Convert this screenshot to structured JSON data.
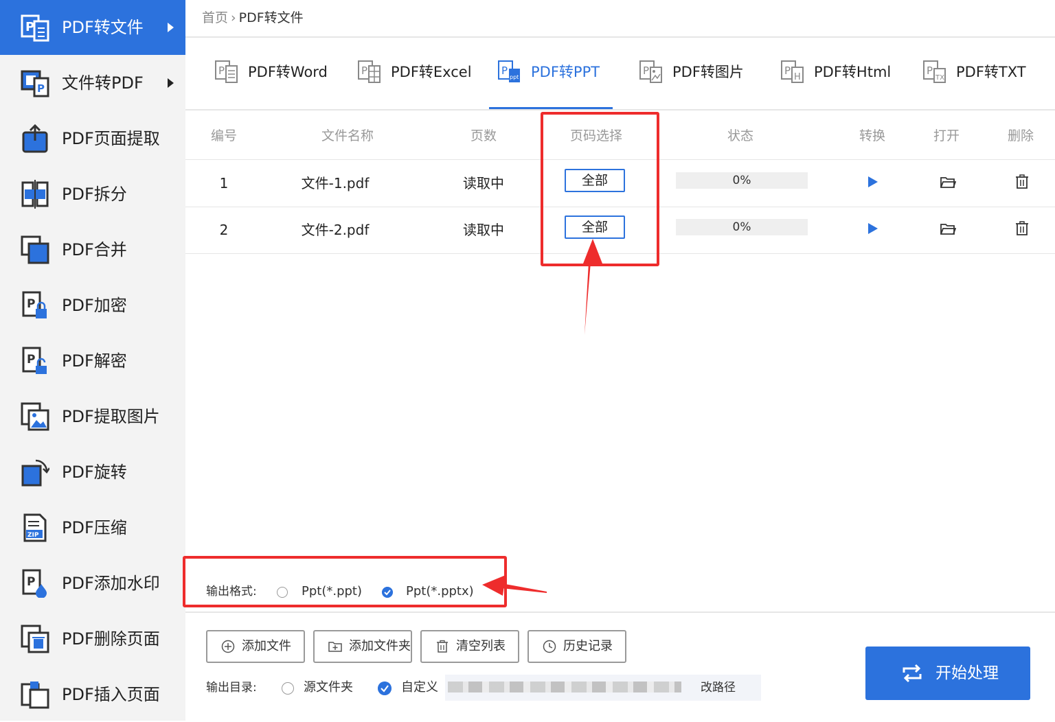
{
  "sidebar": {
    "items": [
      {
        "label": "PDF转文件",
        "icon": "pdf-to-file-icon",
        "active": true,
        "arrow": true
      },
      {
        "label": "文件转PDF",
        "icon": "file-to-pdf-icon",
        "arrow": true
      },
      {
        "label": "PDF页面提取",
        "icon": "page-extract-icon"
      },
      {
        "label": "PDF拆分",
        "icon": "split-icon"
      },
      {
        "label": "PDF合并",
        "icon": "merge-icon"
      },
      {
        "label": "PDF加密",
        "icon": "encrypt-icon"
      },
      {
        "label": "PDF解密",
        "icon": "decrypt-icon"
      },
      {
        "label": "PDF提取图片",
        "icon": "image-extract-icon"
      },
      {
        "label": "PDF旋转",
        "icon": "rotate-icon"
      },
      {
        "label": "PDF压缩",
        "icon": "zip-icon"
      },
      {
        "label": "PDF添加水印",
        "icon": "watermark-icon"
      },
      {
        "label": "PDF删除页面",
        "icon": "delete-page-icon"
      },
      {
        "label": "PDF插入页面",
        "icon": "insert-page-icon"
      }
    ]
  },
  "breadcrumb": {
    "home": "首页",
    "separator": "›",
    "current": "PDF转文件"
  },
  "tabs": [
    {
      "label": "PDF转Word",
      "icon": "word-icon"
    },
    {
      "label": "PDF转Excel",
      "icon": "excel-icon"
    },
    {
      "label": "PDF转PPT",
      "icon": "ppt-icon",
      "active": true
    },
    {
      "label": "PDF转图片",
      "icon": "image-icon"
    },
    {
      "label": "PDF转Html",
      "icon": "html-icon"
    },
    {
      "label": "PDF转TXT",
      "icon": "txt-icon"
    }
  ],
  "table": {
    "headers": [
      "编号",
      "文件名称",
      "页数",
      "页码选择",
      "状态",
      "转换",
      "打开",
      "删除"
    ],
    "rows": [
      {
        "no": "1",
        "name": "文件-1.pdf",
        "pages": "读取中",
        "page_select": "全部",
        "status": "0%"
      },
      {
        "no": "2",
        "name": "文件-2.pdf",
        "pages": "读取中",
        "page_select": "全部",
        "status": "0%"
      }
    ]
  },
  "output_format": {
    "label": "输出格式:",
    "options": [
      {
        "label": "Ppt(*.ppt)",
        "checked": false
      },
      {
        "label": "Ppt(*.pptx)",
        "checked": true
      }
    ]
  },
  "toolbar": {
    "add_file": "添加文件",
    "add_folder": "添加文件夹",
    "clear_list": "清空列表",
    "history": "历史记录"
  },
  "output_dir": {
    "label": "输出目录:",
    "source_folder": "源文件夹",
    "custom": "自定义",
    "selected": "custom",
    "change_path": "改路径"
  },
  "start_button": "开始处理",
  "colors": {
    "accent": "#2c72dd",
    "annotation": "#ee2c2c",
    "sidebar_bg": "#f3f3f3"
  }
}
